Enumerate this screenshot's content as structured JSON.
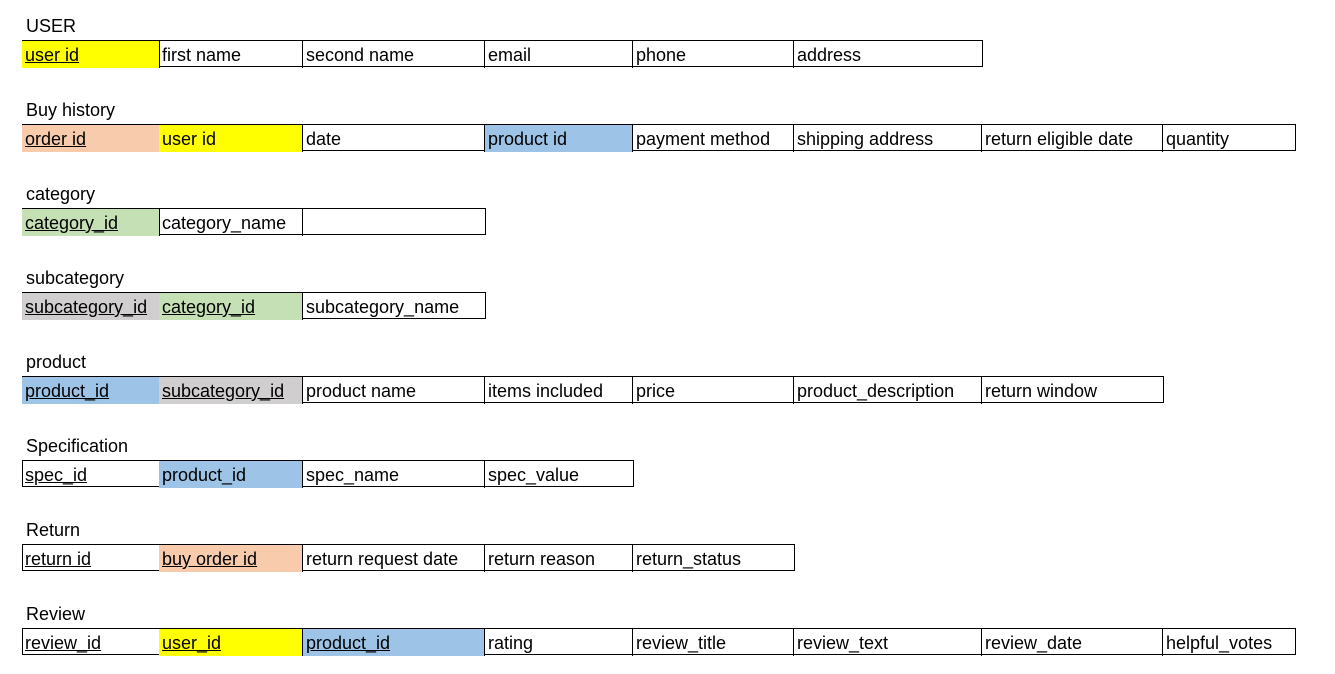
{
  "colors": {
    "user_key": "#ffff00",
    "order_key": "#f8cbad",
    "product_key": "#9dc3e6",
    "category_key": "#c5e0b4",
    "subcategory_key": "#d0cece"
  },
  "tables": [
    {
      "name": "USER",
      "fields": [
        {
          "label": "user id",
          "key": true,
          "color": "#ffff00"
        },
        {
          "label": "first name"
        },
        {
          "label": "second name"
        },
        {
          "label": "email"
        },
        {
          "label": "phone"
        },
        {
          "label": "address"
        }
      ]
    },
    {
      "name": "Buy history",
      "fields": [
        {
          "label": "order id",
          "key": true,
          "color": "#f8cbad"
        },
        {
          "label": "user id",
          "color": "#ffff00"
        },
        {
          "label": "date"
        },
        {
          "label": "product id",
          "color": "#9dc3e6"
        },
        {
          "label": "payment method"
        },
        {
          "label": "shipping address"
        },
        {
          "label": "return eligible date"
        },
        {
          "label": "quantity"
        }
      ]
    },
    {
      "name": "category",
      "fields": [
        {
          "label": "category_id",
          "key": true,
          "color": "#c5e0b4"
        },
        {
          "label": "category_name"
        },
        {
          "label": ""
        }
      ]
    },
    {
      "name": "subcategory",
      "fields": [
        {
          "label": "subcategory_id",
          "key": true,
          "color": "#d0cece"
        },
        {
          "label": "category_id",
          "key": true,
          "color": "#c5e0b4"
        },
        {
          "label": "subcategory_name"
        }
      ]
    },
    {
      "name": "product",
      "fields": [
        {
          "label": "product_id",
          "key": true,
          "color": "#9dc3e6"
        },
        {
          "label": "subcategory_id",
          "key": true,
          "color": "#d0cece"
        },
        {
          "label": "product name"
        },
        {
          "label": "items included"
        },
        {
          "label": "price"
        },
        {
          "label": "product_description"
        },
        {
          "label": "return window"
        }
      ]
    },
    {
      "name": "Specification",
      "fields": [
        {
          "label": "spec_id",
          "key": true
        },
        {
          "label": "product_id",
          "color": "#9dc3e6"
        },
        {
          "label": "spec_name"
        },
        {
          "label": "spec_value"
        }
      ]
    },
    {
      "name": "Return",
      "fields": [
        {
          "label": "return id",
          "key": true
        },
        {
          "label": "buy order id",
          "key": true,
          "color": "#f8cbad"
        },
        {
          "label": "return request date"
        },
        {
          "label": "return reason"
        },
        {
          "label": "return_status"
        }
      ]
    },
    {
      "name": "Review",
      "fields": [
        {
          "label": "review_id",
          "key": true
        },
        {
          "label": "user_id",
          "key": true,
          "color": "#ffff00"
        },
        {
          "label": "product_id",
          "key": true,
          "color": "#9dc3e6"
        },
        {
          "label": "rating"
        },
        {
          "label": "review_title"
        },
        {
          "label": "review_text"
        },
        {
          "label": "review_date"
        },
        {
          "label": "helpful_votes"
        }
      ]
    }
  ]
}
